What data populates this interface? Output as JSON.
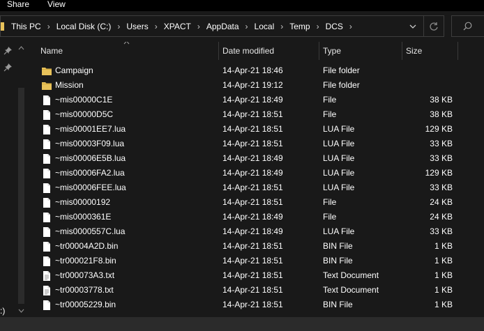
{
  "ribbon": {
    "tabs": [
      "Share",
      "View"
    ]
  },
  "address": {
    "breadcrumbs": [
      "This PC",
      "Local Disk (C:)",
      "Users",
      "XPACT",
      "AppData",
      "Local",
      "Temp",
      "DCS"
    ],
    "separator": "›"
  },
  "columns": {
    "name": "Name",
    "date": "Date modified",
    "type": "Type",
    "size": "Size"
  },
  "nav": {
    "bottom_text": ":)"
  },
  "files": [
    {
      "name": "Campaign",
      "date": "14-Apr-21 18:46",
      "type": "File folder",
      "size": "",
      "icon": "folder-icon"
    },
    {
      "name": "Mission",
      "date": "14-Apr-21 19:12",
      "type": "File folder",
      "size": "",
      "icon": "folder-icon"
    },
    {
      "name": "~mis00000C1E",
      "date": "14-Apr-21 18:49",
      "type": "File",
      "size": "38 KB",
      "icon": "file-icon"
    },
    {
      "name": "~mis00000D5C",
      "date": "14-Apr-21 18:51",
      "type": "File",
      "size": "38 KB",
      "icon": "file-icon"
    },
    {
      "name": "~mis00001EE7.lua",
      "date": "14-Apr-21 18:51",
      "type": "LUA File",
      "size": "129 KB",
      "icon": "file-icon"
    },
    {
      "name": "~mis00003F09.lua",
      "date": "14-Apr-21 18:51",
      "type": "LUA File",
      "size": "33 KB",
      "icon": "file-icon"
    },
    {
      "name": "~mis00006E5B.lua",
      "date": "14-Apr-21 18:49",
      "type": "LUA File",
      "size": "33 KB",
      "icon": "file-icon"
    },
    {
      "name": "~mis00006FA2.lua",
      "date": "14-Apr-21 18:49",
      "type": "LUA File",
      "size": "129 KB",
      "icon": "file-icon"
    },
    {
      "name": "~mis00006FEE.lua",
      "date": "14-Apr-21 18:51",
      "type": "LUA File",
      "size": "33 KB",
      "icon": "file-icon"
    },
    {
      "name": "~mis00000192",
      "date": "14-Apr-21 18:51",
      "type": "File",
      "size": "24 KB",
      "icon": "file-icon"
    },
    {
      "name": "~mis0000361E",
      "date": "14-Apr-21 18:49",
      "type": "File",
      "size": "24 KB",
      "icon": "file-icon"
    },
    {
      "name": "~mis0000557C.lua",
      "date": "14-Apr-21 18:49",
      "type": "LUA File",
      "size": "33 KB",
      "icon": "file-icon"
    },
    {
      "name": "~tr00004A2D.bin",
      "date": "14-Apr-21 18:51",
      "type": "BIN File",
      "size": "1 KB",
      "icon": "file-icon"
    },
    {
      "name": "~tr000021F8.bin",
      "date": "14-Apr-21 18:51",
      "type": "BIN File",
      "size": "1 KB",
      "icon": "file-icon"
    },
    {
      "name": "~tr000073A3.txt",
      "date": "14-Apr-21 18:51",
      "type": "Text Document",
      "size": "1 KB",
      "icon": "text-file-icon"
    },
    {
      "name": "~tr00003778.txt",
      "date": "14-Apr-21 18:51",
      "type": "Text Document",
      "size": "1 KB",
      "icon": "text-file-icon"
    },
    {
      "name": "~tr00005229.bin",
      "date": "14-Apr-21 18:51",
      "type": "BIN File",
      "size": "1 KB",
      "icon": "file-icon"
    }
  ],
  "colors": {
    "background": "#191919",
    "folder": "#e8c25a",
    "border": "#3d3d3d"
  }
}
